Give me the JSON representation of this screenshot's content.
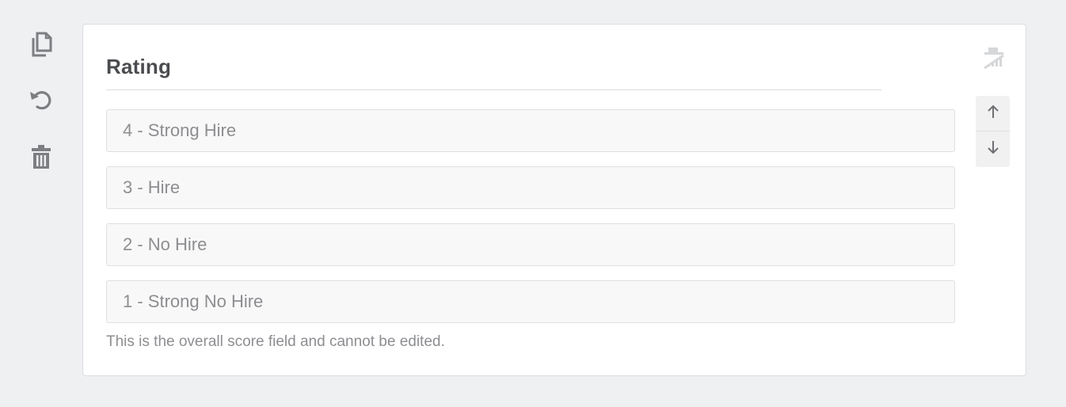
{
  "side_actions": {
    "duplicate_icon": "copy-icon",
    "undo_icon": "undo-icon",
    "delete_icon": "trash-icon"
  },
  "field": {
    "title": "Rating",
    "type_icon": "rating-bars-disabled-icon",
    "options": [
      "4 - Strong Hire",
      "3 - Hire",
      "2 - No Hire",
      "1 - Strong No Hire"
    ],
    "help_text": "This is the overall score field and cannot be edited.",
    "reorder": {
      "up_icon": "arrow-up-icon",
      "down_icon": "arrow-down-icon"
    }
  },
  "colors": {
    "background": "#eff0f2",
    "card": "#ffffff",
    "title": "#4b4c4f",
    "muted_text": "#8d8e91",
    "icon": "#7d7e81",
    "option_bg": "#f8f8f8"
  }
}
